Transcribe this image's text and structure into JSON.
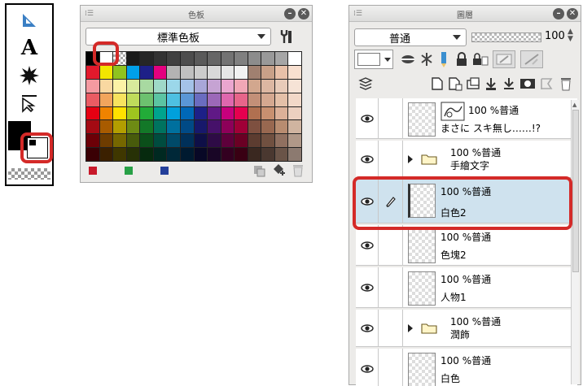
{
  "tool_strip": {
    "items": [
      {
        "name": "ruler-tool-icon",
        "glyph": "◣",
        "color": "#2a6fb3"
      },
      {
        "name": "text-tool-icon",
        "glyph": "A",
        "color": "#000"
      },
      {
        "name": "blend-tool-icon",
        "glyph": "✹",
        "color": "#000"
      },
      {
        "name": "operation-tool-icon",
        "glyph": "⇱",
        "color": "#000"
      }
    ]
  },
  "color_set": {
    "title": "色板",
    "preset": "標準色板",
    "rows": [
      [
        "#000000",
        "#ffffff",
        "checker",
        "#1a1a1a",
        "#262626",
        "#333333",
        "#404040",
        "#4d4d4d",
        "#5a5a5a",
        "#666666",
        "#737373",
        "#808080",
        "#8c8c8c",
        "#999999",
        "#a6a6a6",
        "#ffffff"
      ],
      [
        "#e3192c",
        "#f3e600",
        "#8fc31f",
        "#00a0e9",
        "#1d2088",
        "#e4007f",
        "#b3b3b3",
        "#c0c0c0",
        "#cccccc",
        "#d9d9d9",
        "#e6e6e6",
        "#f2f2f2",
        "#a08070",
        "#c8a088",
        "#e8c0a8",
        "#f8e0d0"
      ],
      [
        "#f49aa1",
        "#f9d8a1",
        "#fcf2a6",
        "#d7ea9c",
        "#a8d9a1",
        "#9fd9c8",
        "#9bd7e9",
        "#a4c2e8",
        "#a8a6d8",
        "#c6a3d3",
        "#eaa6cf",
        "#f1a7b6",
        "#d2a78e",
        "#dcb7a2",
        "#e8cbb9",
        "#f6e3d6"
      ],
      [
        "#ea5b63",
        "#f2a55c",
        "#f7e35f",
        "#bfdc5b",
        "#6cc16f",
        "#5bc4a3",
        "#4ec0e2",
        "#5a97d6",
        "#6a6cc0",
        "#9c68b8",
        "#df67ae",
        "#e7658a",
        "#c39078",
        "#d4a890",
        "#e4c0a8",
        "#f2d8c8"
      ],
      [
        "#e60012",
        "#f08300",
        "#ffe100",
        "#9fc51f",
        "#22ac38",
        "#00a48e",
        "#00a0dc",
        "#0068b7",
        "#1d2088",
        "#601986",
        "#c7007d",
        "#e5004f",
        "#b07050",
        "#c89070",
        "#dcb098",
        "#ecd0c0"
      ],
      [
        "#a40a13",
        "#a85b00",
        "#b39e00",
        "#6e8b14",
        "#137828",
        "#00735f",
        "#00709e",
        "#004a86",
        "#17186b",
        "#46116a",
        "#8d0059",
        "#a00037",
        "#7e5040",
        "#986850",
        "#b88c70",
        "#d0b4a0"
      ],
      [
        "#6c0007",
        "#6e3c00",
        "#766700",
        "#485b0c",
        "#0b4f1a",
        "#004c3f",
        "#004a69",
        "#003059",
        "#0e0f47",
        "#2e0b46",
        "#5e003b",
        "#6a0024",
        "#5c3c30",
        "#705040",
        "#907060",
        "#b09888"
      ],
      [
        "#3a0004",
        "#3b2000",
        "#3f3700",
        "#273106",
        "#062a0e",
        "#002921",
        "#002838",
        "#001a30",
        "#080826",
        "#190626",
        "#330020",
        "#390013",
        "#3a2820",
        "#4a3830",
        "#6a5448",
        "#8c7a70"
      ]
    ],
    "history": [
      "#c8192a",
      "#27a046",
      "#233f9a"
    ],
    "footer_icons": [
      "delete-color-icon",
      "add-color-icon",
      "trash-icon"
    ]
  },
  "layer_panel": {
    "title": "圖層",
    "blend_mode": "普通",
    "opacity": "100",
    "rows": [
      {
        "name": "layer-row-1",
        "type": "vector",
        "line1": "100 %普通",
        "line2": "まさに スキ無し……!?",
        "selected": false,
        "folder": false
      },
      {
        "name": "layer-row-2",
        "type": "folder",
        "line1": "100 %普通",
        "line2": "手繪文字",
        "selected": false,
        "folder": true
      },
      {
        "name": "layer-row-3",
        "type": "raster",
        "line1": "100 %普通",
        "line2": "白色2",
        "selected": true,
        "folder": false
      },
      {
        "name": "layer-row-4",
        "type": "raster",
        "line1": "100 %普通",
        "line2": "色塊2",
        "selected": false,
        "folder": false
      },
      {
        "name": "layer-row-5",
        "type": "raster",
        "line1": "100 %普通",
        "line2": "人物1",
        "selected": false,
        "folder": false
      },
      {
        "name": "layer-row-6",
        "type": "folder",
        "line1": "100 %普通",
        "line2": "潤飾",
        "selected": false,
        "folder": true
      },
      {
        "name": "layer-row-7",
        "type": "raster",
        "line1": "100 %普通",
        "line2": "白色",
        "selected": false,
        "folder": false
      }
    ]
  },
  "colors": {
    "highlight": "#d42a28",
    "selected_row": "#cfe2ee"
  }
}
